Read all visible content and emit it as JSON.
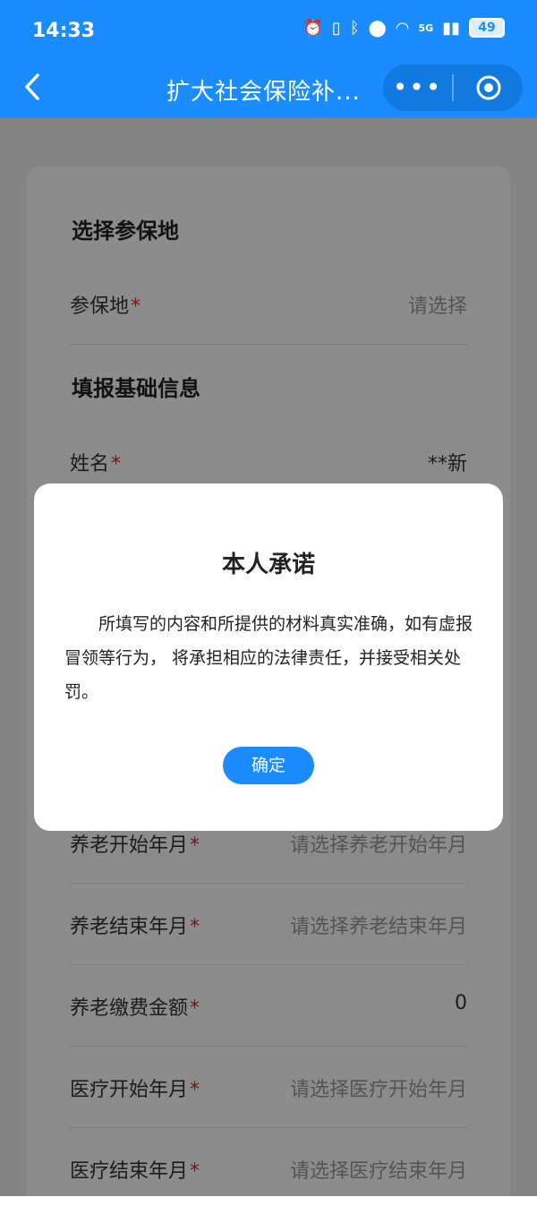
{
  "status_bar": {
    "time": "14:33",
    "network": "5G",
    "battery": "49"
  },
  "navbar": {
    "title": "扩大社会保险补...",
    "more_label": "•••"
  },
  "form": {
    "section1_title": "选择参保地",
    "insured_place": {
      "label": "参保地",
      "required": "*",
      "placeholder": "请选择"
    },
    "section2_title": "填报基础信息",
    "name": {
      "label": "姓名",
      "required": "*",
      "value": "**新"
    },
    "pension_start": {
      "label": "养老开始年月",
      "required": "*",
      "placeholder": "请选择养老开始年月"
    },
    "pension_end": {
      "label": "养老结束年月",
      "required": "*",
      "placeholder": "请选择养老结束年月"
    },
    "pension_amount": {
      "label": "养老缴费金额",
      "required": "*",
      "value": "0"
    },
    "medical_start": {
      "label": "医疗开始年月",
      "required": "*",
      "placeholder": "请选择医疗开始年月"
    },
    "medical_end": {
      "label": "医疗结束年月",
      "required": "*",
      "placeholder": "请选择医疗结束年月"
    }
  },
  "dialog": {
    "title": "本人承诺",
    "body": "所填写的内容和所提供的材料真实准确，如有虚报冒领等行为， 将承担相应的法律责任，并接受相关处罚。",
    "confirm_label": "确定"
  },
  "colors": {
    "primary": "#1a8cff",
    "required": "#e0262b"
  }
}
